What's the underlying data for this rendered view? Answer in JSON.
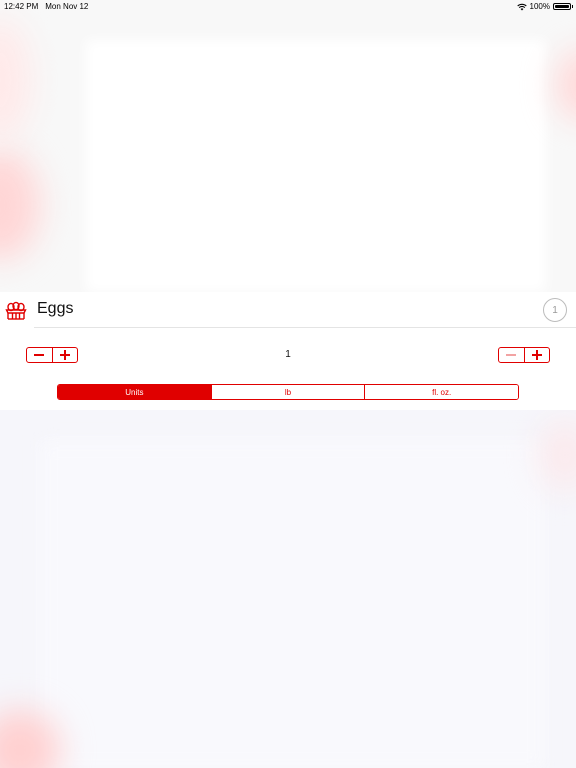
{
  "status_bar": {
    "time": "12:42 PM",
    "date": "Mon Nov 12",
    "battery": "100%",
    "wifi_icon": "wifi-icon",
    "battery_icon": "battery-icon"
  },
  "item": {
    "icon": "egg-carton-icon",
    "title": "Eggs",
    "badge_count": "1",
    "quantity": "1",
    "accent_color": "#e00000"
  },
  "units": {
    "options": [
      "Units",
      "lb",
      "fl. oz."
    ],
    "selected": "Units"
  }
}
